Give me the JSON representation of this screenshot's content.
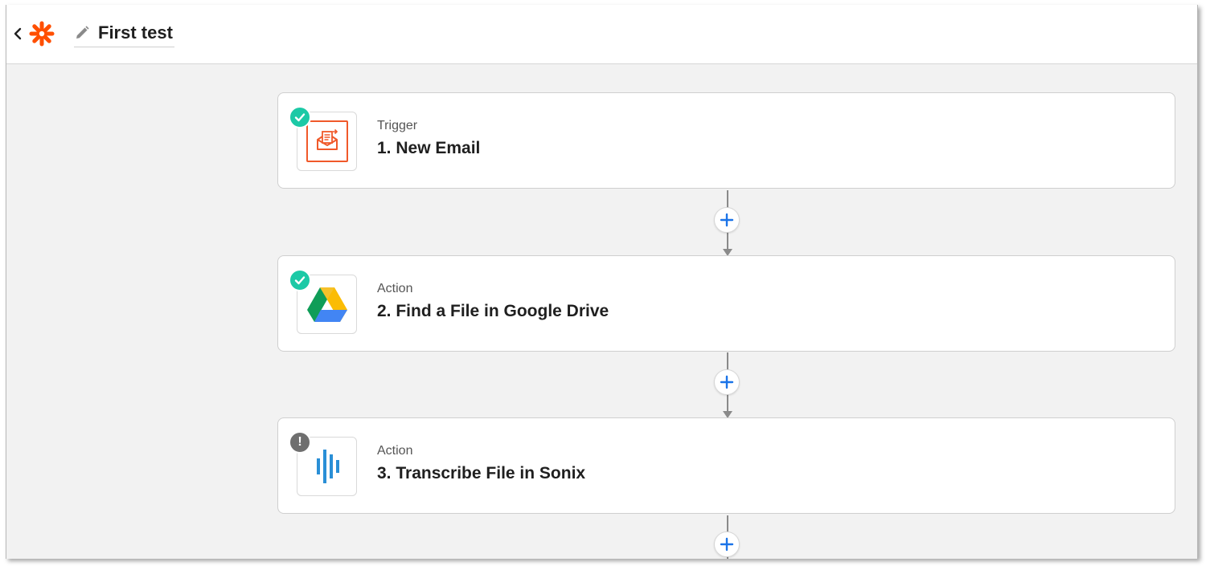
{
  "header": {
    "back_label": "‹",
    "title": "First test"
  },
  "steps": [
    {
      "type": "Trigger",
      "title": "1. New Email",
      "icon": "email-parser-icon",
      "status": "complete"
    },
    {
      "type": "Action",
      "title": "2. Find a File in Google Drive",
      "icon": "google-drive-icon",
      "status": "complete"
    },
    {
      "type": "Action",
      "title": "3. Transcribe File in Sonix",
      "icon": "sonix-icon",
      "status": "warning"
    }
  ],
  "status_warning_glyph": "!",
  "colors": {
    "brand": "#ff4f00",
    "success": "#1cc9a6",
    "warning": "#6f6f6f",
    "add_plus": "#1a73e8",
    "connector": "#8a8a8a",
    "background": "#f2f2f2"
  }
}
